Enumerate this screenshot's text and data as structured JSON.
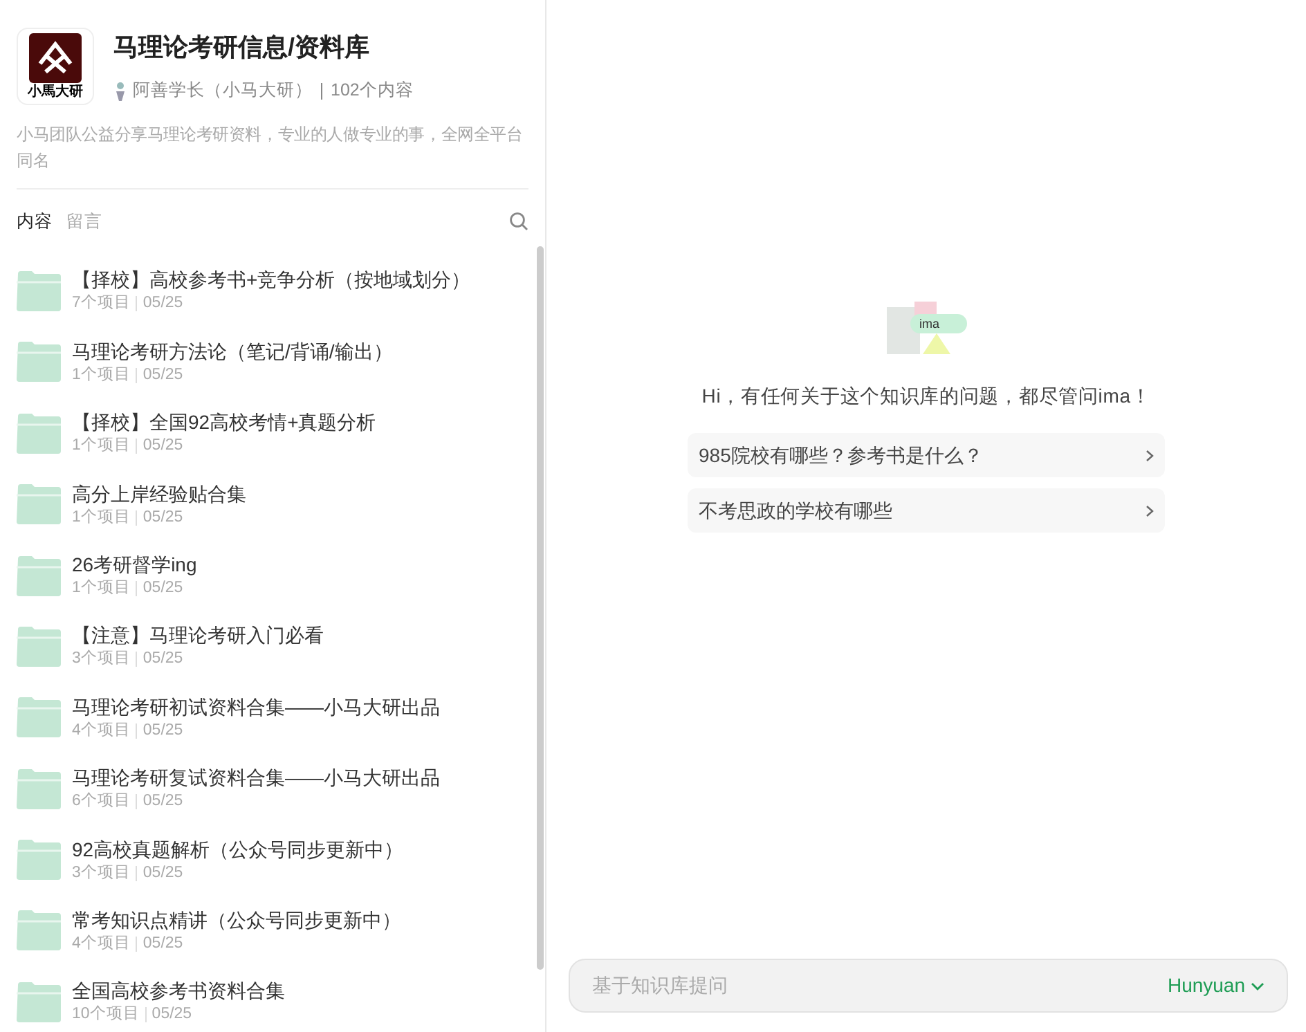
{
  "header": {
    "logo_text": "小馬大研",
    "title": "马理论考研信息/资料库",
    "author": "阿善学长（小马大研）",
    "count": "102个内容",
    "description": "小马团队公益分享马理论考研资料，专业的人做专业的事，全网全平台同名"
  },
  "tabs": [
    {
      "label": "内容",
      "selected": true
    },
    {
      "label": "留言",
      "selected": false
    }
  ],
  "folders": [
    {
      "name": "【择校】高校参考书+竞争分析（按地域划分）",
      "items": "7个项目",
      "date": "05/25"
    },
    {
      "name": "马理论考研方法论（笔记/背诵/输出）",
      "items": "1个项目",
      "date": "05/25"
    },
    {
      "name": "【择校】全国92高校考情+真题分析",
      "items": "1个项目",
      "date": "05/25"
    },
    {
      "name": "高分上岸经验贴合集",
      "items": "1个项目",
      "date": "05/25"
    },
    {
      "name": "26考研督学ing",
      "items": "1个项目",
      "date": "05/25"
    },
    {
      "name": "【注意】马理论考研入门必看",
      "items": "3个项目",
      "date": "05/25"
    },
    {
      "name": "马理论考研初试资料合集——小马大研出品",
      "items": "4个项目",
      "date": "05/25"
    },
    {
      "name": "马理论考研复试资料合集——小马大研出品",
      "items": "6个项目",
      "date": "05/25"
    },
    {
      "name": "92高校真题解析（公众号同步更新中）",
      "items": "3个项目",
      "date": "05/25"
    },
    {
      "name": "常考知识点精讲（公众号同步更新中）",
      "items": "4个项目",
      "date": "05/25"
    },
    {
      "name": "全国高校参考书资料合集",
      "items": "10个项目",
      "date": "05/25"
    }
  ],
  "assistant": {
    "logo_text": "ima",
    "greeting": "Hi，有任何关于这个知识库的问题，都尽管问ima！",
    "suggestions": [
      "985院校有哪些？参考书是什么？",
      "不考思政的学校有哪些"
    ]
  },
  "input": {
    "placeholder": "基于知识库提问",
    "model": "Hunyuan"
  }
}
